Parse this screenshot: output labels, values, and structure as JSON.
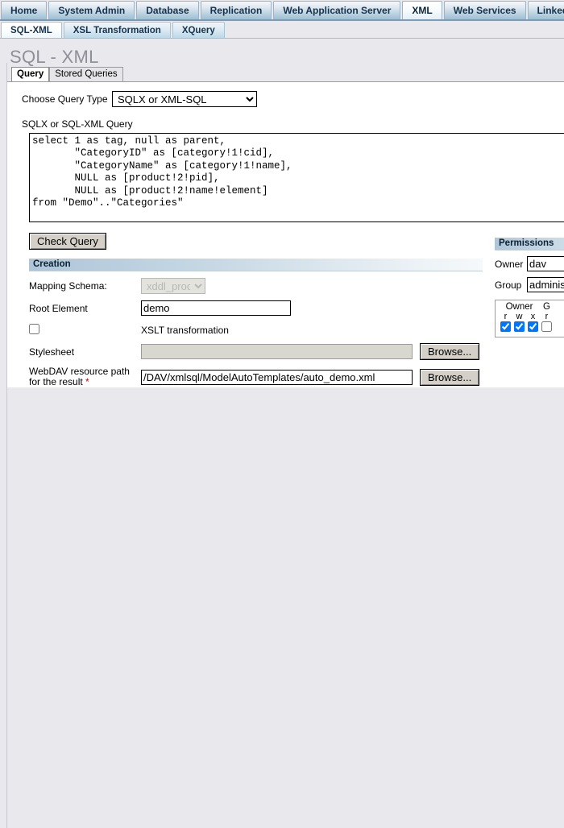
{
  "nav": {
    "primary": [
      {
        "label": "Home",
        "active": false
      },
      {
        "label": "System Admin",
        "active": false
      },
      {
        "label": "Database",
        "active": false
      },
      {
        "label": "Replication",
        "active": false
      },
      {
        "label": "Web Application Server",
        "active": false
      },
      {
        "label": "XML",
        "active": true
      },
      {
        "label": "Web Services",
        "active": false
      },
      {
        "label": "Linked Data",
        "active": false
      }
    ],
    "secondary": [
      {
        "label": "SQL-XML",
        "active": true
      },
      {
        "label": "XSL Transformation",
        "active": false
      },
      {
        "label": "XQuery",
        "active": false
      }
    ]
  },
  "page": {
    "title": "SQL - XML"
  },
  "card": {
    "tabs": [
      {
        "label": "Query",
        "active": true
      },
      {
        "label": "Stored Queries",
        "active": false
      }
    ]
  },
  "query_form": {
    "query_type_label": "Choose Query Type",
    "query_type_value": "SQLX or XML-SQL",
    "query_type_options": [
      "SQLX or XML-SQL"
    ],
    "query_area_label": "SQLX or SQL-XML Query",
    "query_text": "select 1 as tag, null as parent,\n       \"CategoryID\" as [category!1!cid],\n       \"CategoryName\" as [category!1!name],\n       NULL as [product!2!pid],\n       NULL as [product!2!name!element]\nfrom \"Demo\"..\"Categories\"",
    "check_query_label": "Check Query"
  },
  "creation": {
    "section_title": "Creation",
    "mapping_schema_label": "Mapping Schema:",
    "mapping_schema_value": "xddl_procs",
    "mapping_schema_disabled": true,
    "root_element_label": "Root Element",
    "root_element_value": "demo",
    "xslt_label": "XSLT transformation",
    "xslt_checked": false,
    "stylesheet_label": "Stylesheet",
    "stylesheet_value": "",
    "stylesheet_disabled": true,
    "stylesheet_browse_label": "Browse...",
    "webdav_label_line1": "WebDAV resource path",
    "webdav_label_line2": "for the result",
    "webdav_required_mark": "*",
    "webdav_value": "/DAV/xmlsql/ModelAutoTemplates/auto_demo.xml",
    "webdav_browse_label": "Browse..."
  },
  "permissions": {
    "section_title": "Permissions",
    "owner_label": "Owner",
    "owner_value": "dav",
    "group_label": "Group",
    "group_value": "administrators",
    "grid": {
      "group_headers": [
        "Owner",
        "G"
      ],
      "flag_headers": [
        "r",
        "w",
        "x",
        "r"
      ],
      "flags": [
        true,
        true,
        true,
        false
      ]
    }
  },
  "colors": {
    "tab_border": "#9ab3c6",
    "section_bar_start": "#aec6d8",
    "page_bg": "#e9e8ed",
    "title_gray": "#8f8f99",
    "required_red": "#c00000"
  }
}
